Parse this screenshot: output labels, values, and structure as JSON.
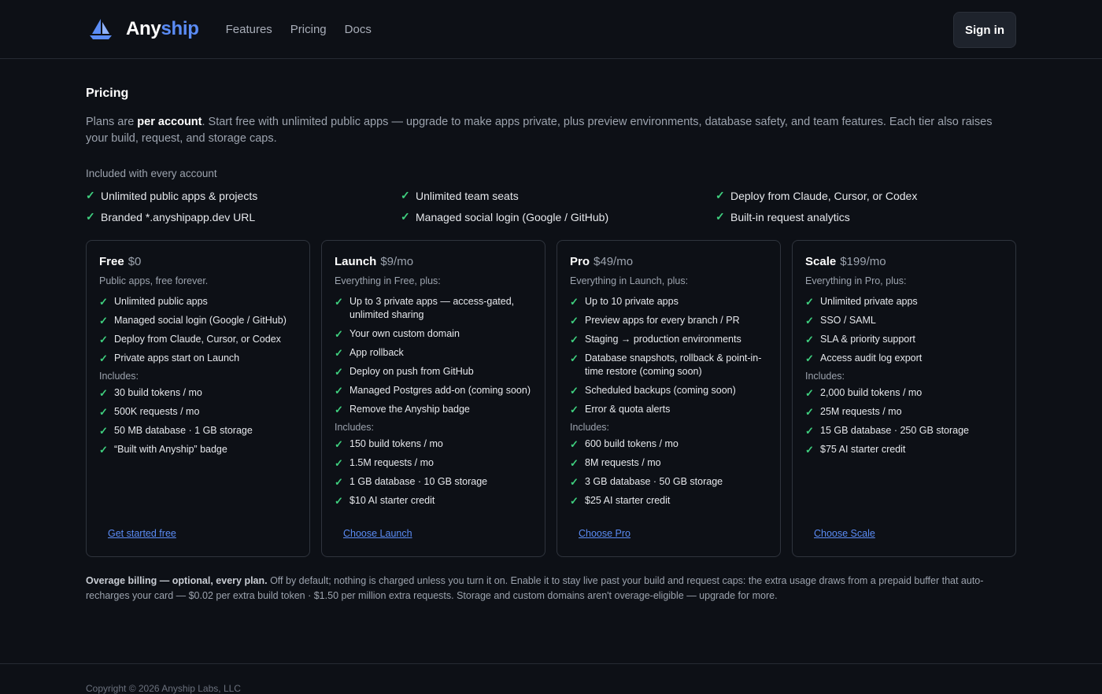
{
  "nav": {
    "brand_a": "Any",
    "brand_b": "ship",
    "links": [
      "Features",
      "Pricing",
      "Docs"
    ],
    "sign_in": "Sign in"
  },
  "pricing": {
    "heading": "Pricing",
    "intro_pre": "Plans are ",
    "intro_bold": "per account",
    "intro_post": ". Start free with unlimited public apps — upgrade to make apps private, plus preview environments, database safety, and team features. Each tier also raises your build, request, and storage caps.",
    "included_heading": "Included with every account",
    "included": [
      "Unlimited public apps & projects",
      "Unlimited team seats",
      "Deploy from Claude, Cursor, or Codex",
      "Branded *.anyshipapp.dev URL",
      "Managed social login (Google / GitHub)",
      "Built-in request analytics"
    ]
  },
  "plans": [
    {
      "name": "Free",
      "price": "$0",
      "subtitle": "Public apps, free forever.",
      "features": [
        "Unlimited public apps",
        "Managed social login (Google / GitHub)",
        "Deploy from Claude, Cursor, or Codex",
        "Private apps start on Launch"
      ],
      "includes_label": "Includes:",
      "includes": [
        "30 build tokens / mo",
        "500K requests / mo",
        "50 MB database · 1 GB storage",
        "“Built with Anyship” badge"
      ],
      "cta": "Get started free"
    },
    {
      "name": "Launch",
      "price": "$9/mo",
      "subtitle": "Everything in Free, plus:",
      "features": [
        "Up to 3 private apps — access-gated, unlimited sharing",
        "Your own custom domain",
        "App rollback",
        "Deploy on push from GitHub",
        "Managed Postgres add-on (coming soon)",
        "Remove the Anyship badge"
      ],
      "includes_label": "Includes:",
      "includes": [
        "150 build tokens / mo",
        "1.5M requests / mo",
        "1 GB database · 10 GB storage",
        "$10 AI starter credit"
      ],
      "cta": "Choose Launch"
    },
    {
      "name": "Pro",
      "price": "$49/mo",
      "subtitle": "Everything in Launch, plus:",
      "features": [
        "Up to 10 private apps",
        "Preview apps for every branch / PR",
        "Staging → production environments",
        "Database snapshots, rollback & point-in-time restore (coming soon)",
        "Scheduled backups (coming soon)",
        "Error & quota alerts"
      ],
      "includes_label": "Includes:",
      "includes": [
        "600 build tokens / mo",
        "8M requests / mo",
        "3 GB database · 50 GB storage",
        "$25 AI starter credit"
      ],
      "cta": "Choose Pro"
    },
    {
      "name": "Scale",
      "price": "$199/mo",
      "subtitle": "Everything in Pro, plus:",
      "features": [
        "Unlimited private apps",
        "SSO / SAML",
        "SLA & priority support",
        "Access audit log export"
      ],
      "includes_label": "Includes:",
      "includes": [
        "2,000 build tokens / mo",
        "25M requests / mo",
        "15 GB database · 250 GB storage",
        "$75 AI starter credit"
      ],
      "cta": "Choose Scale"
    }
  ],
  "overage": {
    "bold": "Overage billing — optional, every plan.",
    "text": " Off by default; nothing is charged unless you turn it on. Enable it to stay live past your build and request caps: the extra usage draws from a prepaid buffer that auto-recharges your card — $0.02 per extra build token · $1.50 per million extra requests. Storage and custom domains aren't overage-eligible — upgrade for more."
  },
  "footer": {
    "copyright": "Copyright © 2026 Anyship Labs, LLC"
  },
  "colors": {
    "accent": "#5b8cf5",
    "check": "#3fd07f",
    "background": "#0d1016"
  }
}
